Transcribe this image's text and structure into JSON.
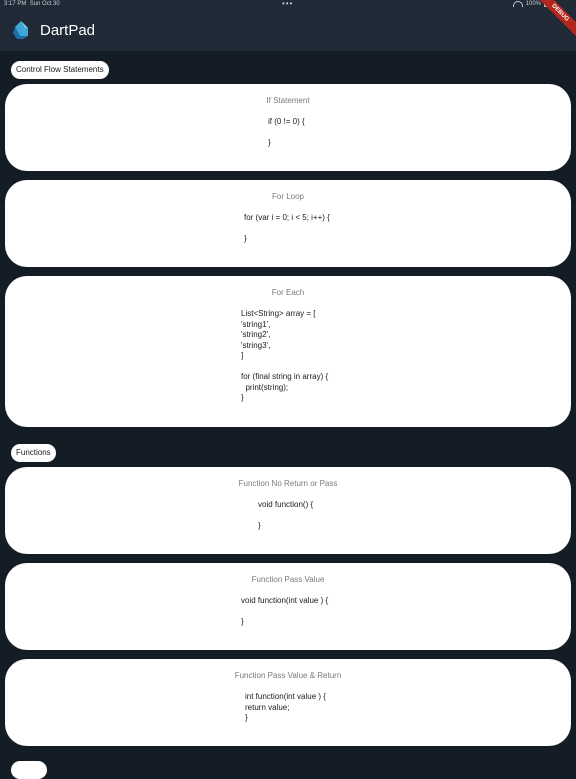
{
  "status_bar": {
    "time": "3:17 PM",
    "date": "Sun Oct 30",
    "dots": "•••",
    "battery": "100%"
  },
  "app_bar": {
    "title": "DartPad",
    "debug_banner": "DEBUG"
  },
  "sections": [
    {
      "label": "Control Flow Statements",
      "cards": [
        {
          "title": "If Statement",
          "code": "if (0 != 0) {\n\n}"
        },
        {
          "title": "For Loop",
          "code": "for (var i = 0; i < 5; i++) {\n\n}"
        },
        {
          "title": "For Each",
          "code": "List<String> array = [\n'string1',\n'string2',\n'string3',\n]\n\nfor (final string in array) {\n  print(string);\n}"
        }
      ]
    },
    {
      "label": "Functions",
      "cards": [
        {
          "title": "Function No Return or Pass",
          "code": "void function() {\n\n}"
        },
        {
          "title": "Function Pass Value",
          "code": "void function(int value ) {\n\n}"
        },
        {
          "title": "Function Pass Value & Return",
          "code": "int function(int value ) {\nreturn value;\n}"
        }
      ]
    }
  ],
  "colors": {
    "background": "#141d26",
    "app_bar": "#1f2a36",
    "card": "#ffffff",
    "title_text": "#7a7a7a",
    "debug_banner": "#b3261e"
  }
}
